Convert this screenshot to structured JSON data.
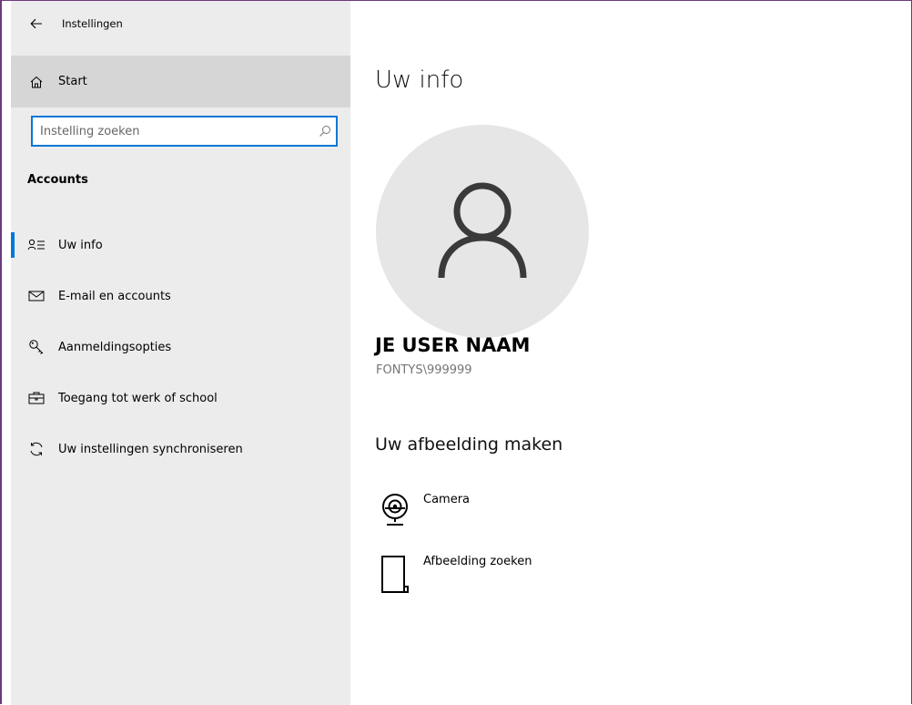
{
  "window": {
    "title": "Instellingen",
    "accent_color": "#0078d7",
    "frame_color": "#6b3a7d"
  },
  "sidebar": {
    "start_label": "Start",
    "search_placeholder": "Instelling zoeken",
    "section_title": "Accounts",
    "items": [
      {
        "label": "Uw info",
        "icon": "user-info-icon",
        "selected": true
      },
      {
        "label": "E-mail en accounts",
        "icon": "mail-icon",
        "selected": false
      },
      {
        "label": "Aanmeldingsopties",
        "icon": "key-icon",
        "selected": false
      },
      {
        "label": "Toegang tot werk of school",
        "icon": "briefcase-icon",
        "selected": false
      },
      {
        "label": "Uw instellingen synchroniseren",
        "icon": "sync-icon",
        "selected": false
      }
    ]
  },
  "main": {
    "page_title": "Uw info",
    "user_name": "JE USER NAAM",
    "user_account": "FONTYS\\999999",
    "picture_heading": "Uw afbeelding maken",
    "options": [
      {
        "label": "Camera",
        "icon": "webcam-icon"
      },
      {
        "label": "Afbeelding zoeken",
        "icon": "browse-file-icon"
      }
    ]
  }
}
